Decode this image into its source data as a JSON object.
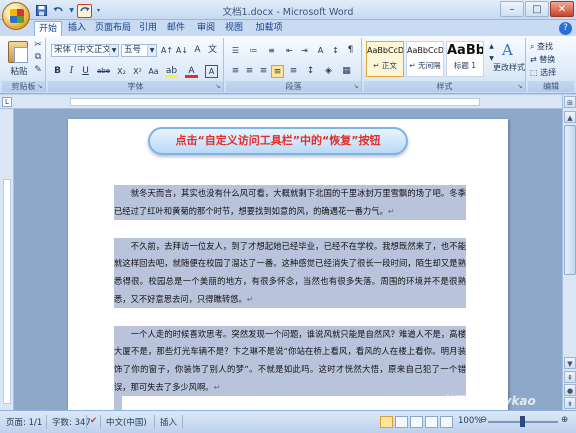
{
  "app": {
    "title": "文档1.docx - Microsoft Word"
  },
  "qat": {
    "save_icon": "save-icon",
    "undo_icon": "undo-icon",
    "redo_icon": "redo-icon"
  },
  "tabs": [
    {
      "label": "开始",
      "active": true
    },
    {
      "label": "插入"
    },
    {
      "label": "页面布局"
    },
    {
      "label": "引用"
    },
    {
      "label": "邮件"
    },
    {
      "label": "审阅"
    },
    {
      "label": "视图"
    },
    {
      "label": "加载项"
    }
  ],
  "ribbon": {
    "clipboard": {
      "paste_label": "粘贴",
      "group_label": "剪贴板"
    },
    "font": {
      "font_name": "宋体 (中文正文)",
      "font_size": "五号",
      "group_label": "字体",
      "bold": "B",
      "italic": "I",
      "underline": "U",
      "strike": "abe",
      "sub": "X₂",
      "sup": "X²",
      "grow": "A↑",
      "shrink": "A↓",
      "clear": "A"
    },
    "paragraph": {
      "group_label": "段落"
    },
    "styles": {
      "group_label": "样式",
      "items": [
        {
          "sample": "AaBbCcDd",
          "name": "↵ 正文"
        },
        {
          "sample": "AaBbCcDd",
          "name": "↵ 无间隔"
        },
        {
          "sample": "AaBb",
          "name": "标题 1"
        }
      ],
      "change_label": "更改样式"
    },
    "editing": {
      "find": "查找",
      "replace": "替换",
      "select": "选择",
      "group_label": "编辑"
    }
  },
  "callout": {
    "text": "点击“自定义访问工具栏”中的“恢复”按钮"
  },
  "document": {
    "paragraphs": [
      "　　就冬天而言，其实也没有什么风可看，大概就剩下北国的千里冰封万里雪飘的场了吧。冬季已经过了红叶和黄菊的那个时节，想要找到如意的风，的确遇花一番力气。",
      "　　不久前，去拜访一位友人，到了才想起她已经毕业，已经不在学校。我想既然来了，也不能就这样回去吧，就随便在校园了溜达了一番。这种感觉已经消失了很长一段时间，陌生却又是熟悉得很。校园总是一个美丽的地方，有很多怀念，当然也有很多失落。周围的环境并不是很熟悉，又不好意思去问，只得瞧转悠。",
      "　　一个人走的时候喜欢思考。突然发现一个问题，谁说风就只能是自然风？难道人不是，高楼大厦不是，那些灯光车辆不是？卞之琳不是说“你站在桥上看风，看风的人在楼上看你。明月装饰了你的窗子，你装饰了别人的梦”。不就是如此吗。这时才恍然大悟，原来自己犯了一个错误，那可失去了多少风啊。"
    ]
  },
  "status": {
    "page": "页面: 1/1",
    "words": "字数: 347",
    "language": "中文(中国)",
    "mode": "插入",
    "zoom": "100%"
  },
  "watermark": "考无忧 Easykao",
  "colors": {
    "accent_red": "#e0302a",
    "selection": "#b9c4dc",
    "ribbon_blue": "#c9dbf2"
  }
}
